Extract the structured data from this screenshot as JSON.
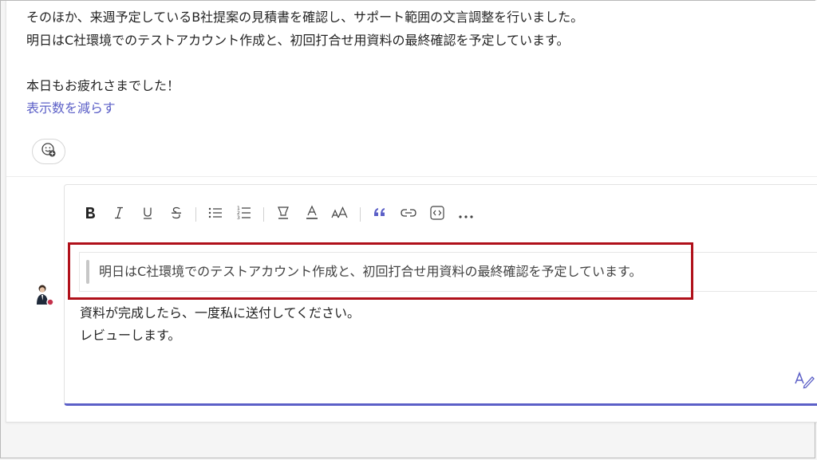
{
  "message": {
    "lines": [
      "そのほか、来週予定しているB社提案の見積書を確認し、サポート範囲の文言調整を行いました。",
      "明日はC社環境でのテストアカウント作成と、初回打合せ用資料の最終確認を予定しています。",
      "本日もお疲れさまでした！"
    ],
    "show_less_label": "表示数を減らす"
  },
  "reaction": {
    "icon": "add-reaction-icon"
  },
  "composer": {
    "toolbar": [
      {
        "name": "bold",
        "icon": "bold-icon"
      },
      {
        "name": "italic",
        "icon": "italic-icon"
      },
      {
        "name": "underline",
        "icon": "underline-icon"
      },
      {
        "name": "strikethrough",
        "icon": "strikethrough-icon"
      },
      {
        "name": "bulleted-list",
        "icon": "bulleted-list-icon"
      },
      {
        "name": "numbered-list",
        "icon": "numbered-list-icon"
      },
      {
        "name": "highlight",
        "icon": "highlight-icon"
      },
      {
        "name": "font-color",
        "icon": "font-color-icon"
      },
      {
        "name": "font-size",
        "icon": "font-size-icon"
      },
      {
        "name": "quote",
        "icon": "quote-icon"
      },
      {
        "name": "link",
        "icon": "link-icon"
      },
      {
        "name": "code",
        "icon": "code-icon"
      },
      {
        "name": "more",
        "icon": "more-icon"
      }
    ],
    "quote_text": "明日はC社環境でのテストアカウント作成と、初回打合せ用資料の最終確認を予定しています。",
    "body_lines": [
      "資料が完成したら、一度私に送付してください。",
      "レビューします。"
    ]
  },
  "colors": {
    "accent": "#5b5fc7",
    "highlight_border": "#b0101a",
    "presence_busy": "#c4314b"
  }
}
